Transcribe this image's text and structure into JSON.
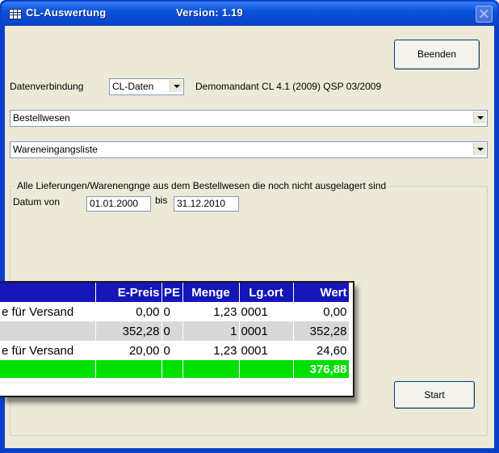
{
  "window": {
    "app_title": "CL-Auswertung",
    "version": "Version: 1.19"
  },
  "toolbar": {
    "beenden_label": "Beenden",
    "start_label": "Start"
  },
  "connection": {
    "label": "Datenverbindung",
    "selected": "CL-Daten",
    "description": "Demomandant CL 4.1 (2009) QSP 03/2009"
  },
  "module_select": {
    "selected": "Bestellwesen"
  },
  "report_select": {
    "selected": "Wareneingangsliste"
  },
  "groupbox": {
    "legend": "Alle Lieferungen/Warenengnge aus dem Bestellwesen die noch nicht ausgelagert sind",
    "datum_von_label": "Datum von",
    "datum_von_value": "01.01.2000",
    "bis_label": "bis",
    "bis_value": "31.12.2010"
  },
  "result_table": {
    "headers": [
      "E-Preis",
      "PE",
      "Menge",
      "Lg.ort",
      "Wert"
    ],
    "rows": [
      {
        "desc": "e für Versand",
        "epreis": "0,00",
        "pe": "0",
        "menge": "1,23",
        "lgort": "0001",
        "wert": "0,00"
      },
      {
        "desc": "",
        "epreis": "352,28",
        "pe": "0",
        "menge": "1",
        "lgort": "0001",
        "wert": "352,28"
      },
      {
        "desc": "e für Versand",
        "epreis": "20,00",
        "pe": "0",
        "menge": "1,23",
        "lgort": "0001",
        "wert": "24,60"
      }
    ],
    "total": "376,88"
  },
  "colors": {
    "title_bar": "#0a52dd",
    "table_header": "#1515b8",
    "total_row": "#00e000",
    "client_bg": "#ece9d8"
  }
}
